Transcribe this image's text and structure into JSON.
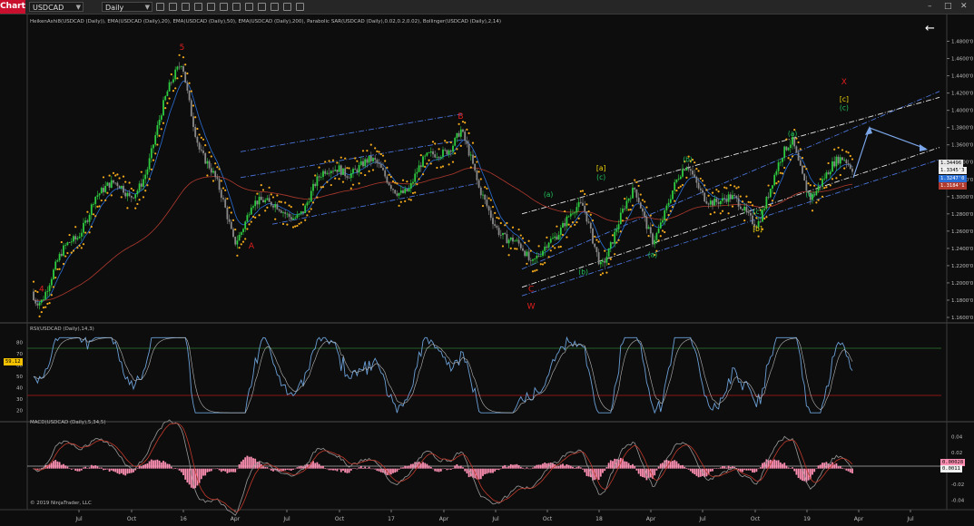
{
  "toolbar": {
    "chart_tab": "Chart",
    "instrument": "USDCAD",
    "interval": "Daily",
    "window_buttons": {
      "minimize": "–",
      "restore": "□",
      "close": "✕"
    },
    "back_arrow": "←"
  },
  "colors": {
    "background": "#0d0d0d",
    "bull_candle": "#2ecc40",
    "bear_candle": "#8a8a8a",
    "sar_dots": "#f2a91c",
    "ema20": "#2a6fd6",
    "ema200": "#b03a2e",
    "channel_blue": "#4a74d8",
    "channel_white": "#e8e8e8",
    "wave_red": "#e01e1e",
    "wave_green": "#22c55e",
    "wave_yellow": "#f5d90a",
    "rsi_line": "#b8b8b8",
    "rsi_upper": "#2e7d32",
    "rsi_lower": "#b71c1c",
    "macd_line": "#d4d4d4",
    "macd_signal": "#c0392b",
    "macd_hist": "#ff8fb3"
  },
  "panels": {
    "price": {
      "indicators_label": "HeikenAshi8(USDCAD (Daily)), EMA(USDCAD (Daily),20), EMA(USDCAD (Daily),50), EMA(USDCAD (Daily),200), Parabolic SAR(USDCAD (Daily),0.02,0.2,0.02), Bollinger(USDCAD (Daily),2,14)",
      "y_ticks": [
        "1.4800'0",
        "1.4600'0",
        "1.4400'0",
        "1.4200'0",
        "1.4000'0",
        "1.3800'0",
        "1.3600'0",
        "1.3400'0",
        "1.3200'0",
        "1.3000'0",
        "1.2800'0",
        "1.2600'0",
        "1.2400'0",
        "1.2200'0",
        "1.2000'0",
        "1.1800'0",
        "1.1600'0"
      ],
      "price_tags": [
        {
          "label": "1.34496",
          "bg": "#e6e6e6",
          "fg": "#000000"
        },
        {
          "label": "1.3345'3",
          "bg": "#f0f0f0",
          "fg": "#000000"
        },
        {
          "label": "1.3247'0",
          "bg": "#2a6fd6",
          "fg": "#ffffff"
        },
        {
          "label": "1.3184'1",
          "bg": "#b03a2e",
          "fg": "#ffffff"
        }
      ]
    },
    "rsi": {
      "label": "RSI(USDCAD (Daily),14,3)",
      "y_ticks": [
        "80",
        "70",
        "60",
        "50",
        "40",
        "30",
        "20"
      ],
      "current": "59.12"
    },
    "macd": {
      "label": "MACD(USDCAD (Daily),5,34,5)",
      "y_ticks": [
        "0.04",
        "0.02",
        "0",
        "-0.02",
        "-0.04"
      ],
      "tags": [
        {
          "label": "0.00028",
          "bg": "#ff8fb3",
          "fg": "#000000"
        },
        {
          "label": "0.0011",
          "bg": "#f0f0f0",
          "fg": "#000000"
        }
      ]
    }
  },
  "x_axis": {
    "labels": [
      "Jul",
      "Oct",
      "16",
      "Apr",
      "Jul",
      "Oct",
      "17",
      "Apr",
      "Jul",
      "Oct",
      "18",
      "Apr",
      "Jul",
      "Oct",
      "19",
      "Apr",
      "Jul"
    ]
  },
  "copyright": "© 2019 NinjaTrader, LLC",
  "chart_data": [
    {
      "type": "line",
      "description_of_series": "USDCAD daily Heiken Ashi price path (approximate turning points)",
      "x": [
        "2015-05",
        "2015-07",
        "2015-08",
        "2015-10",
        "2015-11",
        "2016-01",
        "2016-02",
        "2016-04",
        "2016-05",
        "2016-06",
        "2016-08",
        "2016-10",
        "2016-12",
        "2017-02",
        "2017-04",
        "2017-05",
        "2017-06",
        "2017-08",
        "2017-09",
        "2017-10",
        "2017-12",
        "2018-01",
        "2018-03",
        "2018-04",
        "2018-06",
        "2018-08",
        "2018-10",
        "2018-12",
        "2019-01",
        "2019-02",
        "2019-03"
      ],
      "y": [
        1.19,
        1.25,
        1.31,
        1.3,
        1.34,
        1.46,
        1.36,
        1.25,
        1.3,
        1.28,
        1.29,
        1.34,
        1.33,
        1.31,
        1.36,
        1.38,
        1.3,
        1.25,
        1.21,
        1.26,
        1.28,
        1.23,
        1.3,
        1.26,
        1.33,
        1.29,
        1.28,
        1.36,
        1.31,
        1.32,
        1.34
      ],
      "ylim": [
        1.16,
        1.49
      ],
      "wave_labels": [
        {
          "text": "4",
          "color": "red",
          "x": "2015-05",
          "y": 1.19
        },
        {
          "text": "5",
          "color": "red",
          "x": "2016-01",
          "y": 1.47
        },
        {
          "text": "A",
          "color": "red",
          "x": "2016-05",
          "y": 1.24
        },
        {
          "text": "B",
          "color": "red",
          "x": "2017-05",
          "y": 1.39
        },
        {
          "text": "C",
          "color": "red",
          "x": "2017-09",
          "y": 1.19
        },
        {
          "text": "W",
          "color": "red",
          "x": "2017-09",
          "y": 1.17
        },
        {
          "text": "(a)",
          "color": "green",
          "x": "2017-10",
          "y": 1.3
        },
        {
          "text": "(b)",
          "color": "green",
          "x": "2017-12",
          "y": 1.21
        },
        {
          "text": "[a]",
          "color": "yellow",
          "x": "2018-01",
          "y": 1.33
        },
        {
          "text": "(c)",
          "color": "green",
          "x": "2018-01",
          "y": 1.32
        },
        {
          "text": "(a)",
          "color": "green",
          "x": "2018-04",
          "y": 1.23
        },
        {
          "text": "(b)",
          "color": "green",
          "x": "2018-06",
          "y": 1.34
        },
        {
          "text": "(c)",
          "color": "green",
          "x": "2018-10",
          "y": 1.28
        },
        {
          "text": "[b]",
          "color": "yellow",
          "x": "2018-10",
          "y": 1.26
        },
        {
          "text": "(a)",
          "color": "green",
          "x": "2018-12",
          "y": 1.37
        },
        {
          "text": "(b)",
          "color": "green",
          "x": "2019-01",
          "y": 1.3
        },
        {
          "text": "X",
          "color": "red",
          "x": "2019-03",
          "y": 1.43
        },
        {
          "text": "[c]",
          "color": "yellow",
          "x": "2019-03",
          "y": 1.41
        },
        {
          "text": "(c)",
          "color": "green",
          "x": "2019-03",
          "y": 1.4
        }
      ]
    },
    {
      "type": "line",
      "name": "RSI(USDCAD (Daily),14,3)",
      "ylim": [
        15,
        85
      ],
      "levels": [
        70,
        30
      ]
    },
    {
      "type": "bar",
      "name": "MACD(USDCAD (Daily),5,34,5)",
      "ylim": [
        -0.045,
        0.05
      ]
    }
  ]
}
